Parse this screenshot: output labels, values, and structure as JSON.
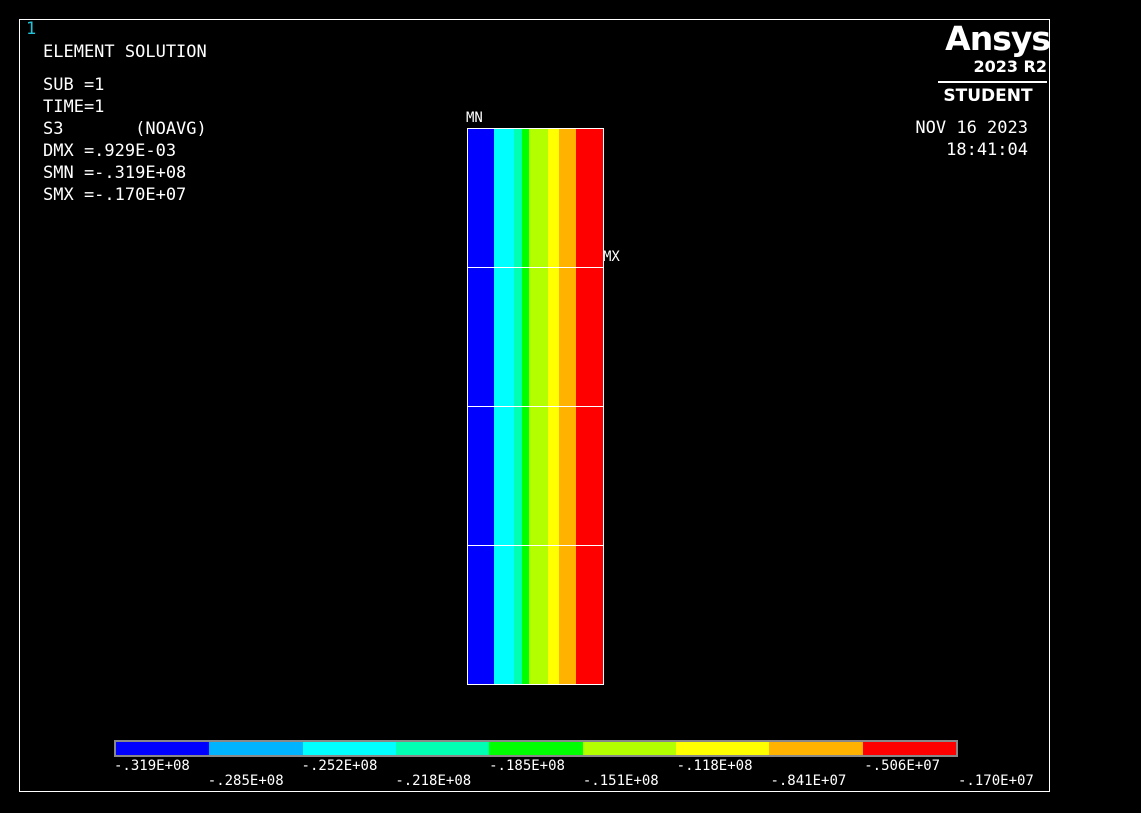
{
  "window_number": "1",
  "solution_title": "ELEMENT SOLUTION",
  "info": {
    "sub": "SUB =1",
    "time": "TIME=1",
    "item": "S3       (NOAVG)",
    "dmx": "DMX =.929E-03",
    "smn": "SMN =-.319E+08",
    "smx": "SMX =-.170E+07"
  },
  "logo": {
    "brand": "Ansys",
    "version": "2023 R2",
    "edition": "STUDENT"
  },
  "date": "NOV 16 2023",
  "time_stamp": "18:41:04",
  "min_marker": "MN",
  "max_marker": "MX",
  "contour_colors": [
    "#0000ff",
    "#00b3ff",
    "#00ffff",
    "#00ffb3",
    "#00ff00",
    "#b3ff00",
    "#ffff00",
    "#ffb300",
    "#ff0000"
  ],
  "model_band_colors": [
    "#0000ff",
    "#00ffff",
    "#00ffb3",
    "#00ff00",
    "#b3ff00",
    "#ffff00",
    "#ffb300",
    "#ff0000"
  ],
  "legend_labels_top": [
    "-.319E+08",
    "-.252E+08",
    "-.185E+08",
    "-.118E+08",
    "-.506E+07"
  ],
  "legend_labels_bottom": [
    "-.285E+08",
    "-.218E+08",
    "-.151E+08",
    "-.841E+07",
    "-.170E+07"
  ]
}
